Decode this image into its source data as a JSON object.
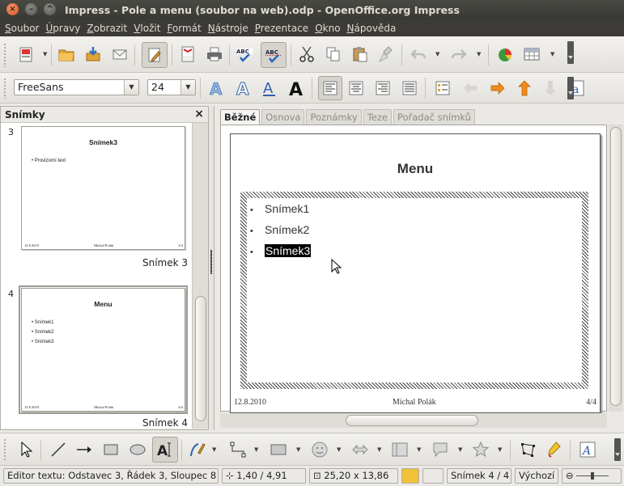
{
  "window": {
    "title": "Impress - Pole a menu (soubor na web).odp - OpenOffice.org Impress",
    "close": "×",
    "minimize": "–",
    "maximize": "^"
  },
  "menu": [
    "Soubor",
    "Úpravy",
    "Zobrazit",
    "Vložit",
    "Formát",
    "Nástroje",
    "Prezentace",
    "Okno",
    "Nápověda"
  ],
  "format_toolbar": {
    "font_name": "FreeSans",
    "font_size": "24"
  },
  "slide_pane": {
    "title": "Snímky",
    "close": "×",
    "thumbnails": [
      {
        "number": "3",
        "title": "Snímek3",
        "bullets": [
          "Provizorní text"
        ],
        "footer_date": "12.8.2010",
        "footer_author": "Michal Polák",
        "footer_page": "3/4",
        "label": "Snímek 3"
      },
      {
        "number": "4",
        "title": "Menu",
        "bullets": [
          "Snímek1",
          "Snímek2",
          "Snímek3"
        ],
        "footer_date": "12.8.2010",
        "footer_author": "Michal Polák",
        "footer_page": "4/4",
        "label": "Snímek 4"
      }
    ]
  },
  "tabs": [
    "Běžné",
    "Osnova",
    "Poznámky",
    "Teze",
    "Pořadač snímků"
  ],
  "slide": {
    "title": "Menu",
    "bullet_char": "•",
    "bullets": [
      "Snímek1",
      "Snímek2",
      "Snímek3"
    ],
    "footer_date": "12.8.2010",
    "footer_author": "Michal Polák",
    "footer_page": "4/4"
  },
  "statusbar": {
    "mode": "Editor textu: Odstavec 3, Řádek 3, Sloupec 8",
    "position": "1,40 / 4,91",
    "size": "25,20 x 13,86",
    "slide": "Snímek 4 / 4",
    "layout": "Výchozí"
  },
  "colors": {
    "titlebar": "#3c3b37",
    "close_button": "#e2622b",
    "selection": "#000000"
  }
}
